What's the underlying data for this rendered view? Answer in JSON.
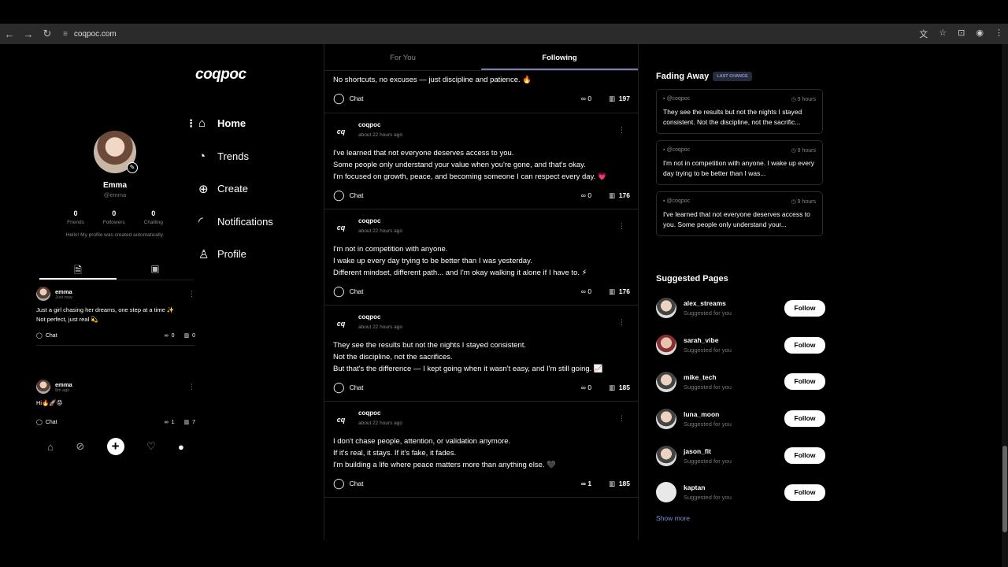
{
  "browser": {
    "url": "coqpoc.com"
  },
  "app": {
    "logo": "coqpoc"
  },
  "menu": {
    "items": [
      {
        "label": "Home",
        "icon": "home-icon"
      },
      {
        "label": "Trends",
        "icon": "trends-icon"
      },
      {
        "label": "Create",
        "icon": "create-icon"
      },
      {
        "label": "Notifications",
        "icon": "notifications-icon"
      },
      {
        "label": "Profile",
        "icon": "profile-icon"
      }
    ]
  },
  "profile": {
    "name": "Emma",
    "handle": "@emma",
    "stats": [
      {
        "n": "0",
        "l": "Friends"
      },
      {
        "n": "0",
        "l": "Followers"
      },
      {
        "n": "0",
        "l": "Chatting"
      }
    ],
    "bio": "Hello! My profile was created automatically."
  },
  "profile_posts": [
    {
      "name": "emma",
      "time": "Just now",
      "text": "Just a girl chasing her dreams, one step at a time ✨\nNot perfect, just real 💫",
      "chat": "Chat",
      "infinity": "0",
      "views": "0"
    },
    {
      "name": "emma",
      "time": "8m ago",
      "text": "Hi🔥🚀😡",
      "chat": "Chat",
      "infinity": "1",
      "views": "7"
    }
  ],
  "feed": {
    "tabs": [
      "For You",
      "Following"
    ],
    "top_post": {
      "text": "No shortcuts, no excuses — just discipline and patience. 🔥",
      "chat": "Chat",
      "infinity": "0",
      "views": "197"
    },
    "posts": [
      {
        "author": "coqpoc",
        "time": "about 22 hours ago",
        "text": "I've learned that not everyone deserves access to you.\nSome people only understand your value when you're gone, and that's okay.\nI'm focused on growth, peace, and becoming someone I can respect every day. 💗",
        "chat": "Chat",
        "infinity": "0",
        "views": "176"
      },
      {
        "author": "coqpoc",
        "time": "about 22 hours ago",
        "text": "I'm not in competition with anyone.\nI wake up every day trying to be better than I was yesterday.\nDifferent mindset, different path... and I'm okay walking it alone if I have to. ⚡",
        "chat": "Chat",
        "infinity": "0",
        "views": "176"
      },
      {
        "author": "coqpoc",
        "time": "about 22 hours ago",
        "text": "They see the results but not the nights I stayed consistent.\nNot the discipline, not the sacrifices.\nBut that's the difference — I kept going when it wasn't easy, and I'm still going. 📈",
        "chat": "Chat",
        "infinity": "0",
        "views": "185"
      },
      {
        "author": "coqpoc",
        "time": "about 22 hours ago",
        "text": "I don't chase people, attention, or validation anymore.\nIf it's real, it stays. If it's fake, it fades.\nI'm building a life where peace matters more than anything else. 🖤",
        "chat": "Chat",
        "infinity": "1",
        "views": "185"
      }
    ]
  },
  "fading": {
    "title": "Fading Away",
    "badge": "LAST CHANCE",
    "cards": [
      {
        "handle": "@coqpoc",
        "time": "9 hours",
        "text": "They see the results but not the nights I stayed consistent. Not the discipline, not the sacrific..."
      },
      {
        "handle": "@coqpoc",
        "time": "9 hours",
        "text": "I'm not in competition with anyone. I wake up every day trying to be better than I was..."
      },
      {
        "handle": "@coqpoc",
        "time": "9 hours",
        "text": "I've learned that not everyone deserves access to you. Some people only understand your..."
      }
    ]
  },
  "suggested": {
    "title": "Suggested Pages",
    "follow_label": "Follow",
    "more": "Show more",
    "items": [
      {
        "name": "alex_streams",
        "sub": "Suggested for you"
      },
      {
        "name": "sarah_vibe",
        "sub": "Suggested for you"
      },
      {
        "name": "mike_tech",
        "sub": "Suggested for you"
      },
      {
        "name": "luna_moon",
        "sub": "Suggested for you"
      },
      {
        "name": "jason_fit",
        "sub": "Suggested for you"
      },
      {
        "name": "kaptan",
        "sub": "Suggested for you"
      }
    ]
  }
}
